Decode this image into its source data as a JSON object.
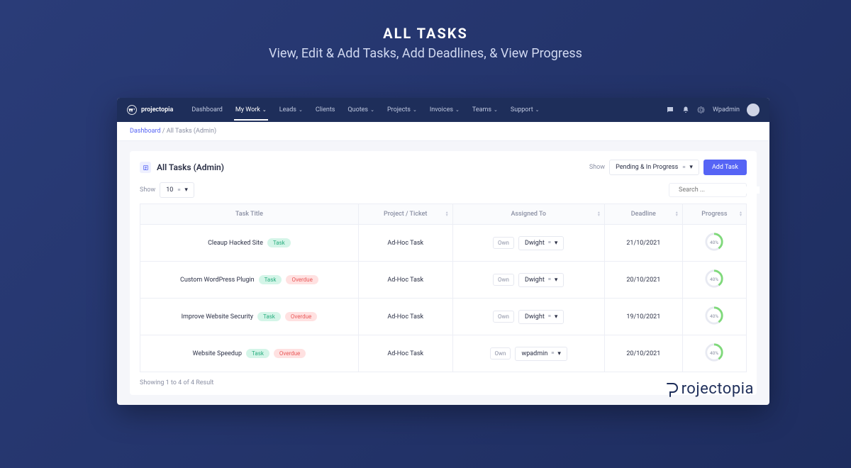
{
  "hero": {
    "title": "ALL TASKS",
    "subtitle": "View, Edit & Add Tasks, Add Deadlines, & View Progress"
  },
  "brand": "projectopia",
  "nav": {
    "items": [
      {
        "label": "Dashboard",
        "caret": false
      },
      {
        "label": "My Work",
        "caret": true,
        "active": true
      },
      {
        "label": "Leads",
        "caret": true
      },
      {
        "label": "Clients",
        "caret": false
      },
      {
        "label": "Quotes",
        "caret": true
      },
      {
        "label": "Projects",
        "caret": true
      },
      {
        "label": "Invoices",
        "caret": true
      },
      {
        "label": "Teams",
        "caret": true
      },
      {
        "label": "Support",
        "caret": true
      }
    ]
  },
  "user": "Wpadmin",
  "breadcrumb": {
    "root": "Dashboard",
    "sep": " / ",
    "current": "All Tasks (Admin)"
  },
  "page": {
    "title": "All Tasks (Admin)"
  },
  "filter": {
    "prefix": "Show",
    "value": "Pending & In Progress"
  },
  "add_button": "Add Task",
  "per_page": {
    "prefix": "Show",
    "value": "10"
  },
  "search": {
    "placeholder": "Search ..."
  },
  "columns": [
    "Task Title",
    "Project / Ticket",
    "Assigned To",
    "Deadline",
    "Progress"
  ],
  "rows": [
    {
      "title": "Cleaup Hacked Site",
      "type": "Task",
      "overdue": false,
      "project": "Ad-Hoc Task",
      "owner_badge": "Own",
      "assignee": "Dwight",
      "deadline": "21/10/2021",
      "progress": 40
    },
    {
      "title": "Custom WordPress Plugin",
      "type": "Task",
      "overdue": true,
      "project": "Ad-Hoc Task",
      "owner_badge": "Own",
      "assignee": "Dwight",
      "deadline": "20/10/2021",
      "progress": 40
    },
    {
      "title": "Improve Website Security",
      "type": "Task",
      "overdue": true,
      "project": "Ad-Hoc Task",
      "owner_badge": "Own",
      "assignee": "Dwight",
      "deadline": "19/10/2021",
      "progress": 40
    },
    {
      "title": "Website Speedup",
      "type": "Task",
      "overdue": true,
      "project": "Ad-Hoc Task",
      "owner_badge": "Own",
      "assignee": "wpadmin",
      "deadline": "20/10/2021",
      "progress": 40
    }
  ],
  "badge_labels": {
    "task": "Task",
    "overdue": "Overdue"
  },
  "footer": "Showing 1 to 4 of 4 Result",
  "brand_footer": "rojectopia"
}
